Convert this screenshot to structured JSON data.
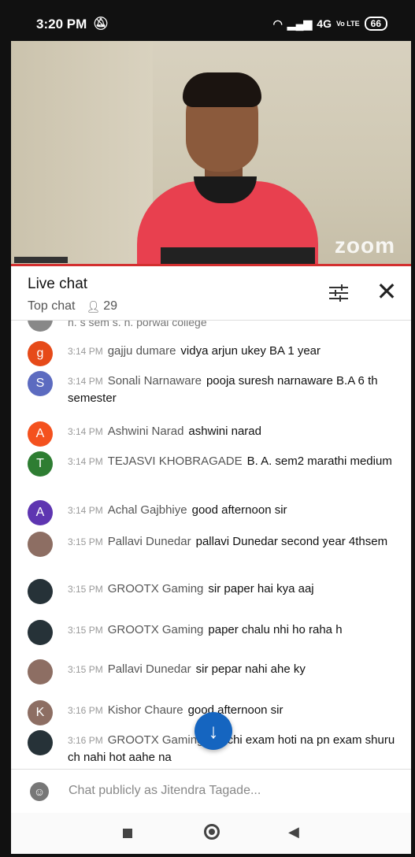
{
  "status_bar": {
    "time": "3:20 PM",
    "network": "4G",
    "volte": "Vo LTE",
    "battery": "66"
  },
  "video": {
    "watermark": "zoom"
  },
  "chat_header": {
    "title": "Live chat",
    "mode": "Top chat",
    "viewers": "29"
  },
  "partial_message": "h. s sem s. n. porwal college",
  "messages": [
    {
      "time": "3:14 PM",
      "author": "gajju dumare",
      "text": "vidya arjun ukey BA 1 year",
      "avatar_letter": "g",
      "avatar_color": "#e64a19"
    },
    {
      "time": "3:14 PM",
      "author": "Sonali Narnaware",
      "text": "pooja suresh narnaware B.A 6 th semester",
      "avatar_letter": "S",
      "avatar_color": "#5c6bc0"
    },
    {
      "time": "3:14 PM",
      "author": "Ashwini Narad",
      "text": "ashwini narad",
      "avatar_letter": "A",
      "avatar_color": "#f4511e"
    },
    {
      "time": "3:14 PM",
      "author": "TEJASVI KHOBRAGADE",
      "text": "B. A. sem2 marathi medium",
      "avatar_letter": "T",
      "avatar_color": "#2e7d32"
    },
    {
      "time": "3:14 PM",
      "author": "Achal Gajbhiye",
      "text": "good afternoon sir",
      "avatar_letter": "A",
      "avatar_color": "#5e35b1"
    },
    {
      "time": "3:15 PM",
      "author": "Pallavi Dunedar",
      "text": "pallavi Dunedar second year 4thsem",
      "avatar_letter": "",
      "avatar_color": "#8d6e63"
    },
    {
      "time": "3:15 PM",
      "author": "GROOTX Gaming",
      "text": "sir paper hai kya aaj",
      "avatar_letter": "",
      "avatar_color": "#263238"
    },
    {
      "time": "3:15 PM",
      "author": "GROOTX Gaming",
      "text": "paper chalu nhi ho raha h",
      "avatar_letter": "",
      "avatar_color": "#263238"
    },
    {
      "time": "3:15 PM",
      "author": "Pallavi Dunedar",
      "text": "sir pepar nahi ahe ky",
      "avatar_letter": "",
      "avatar_color": "#8d6e63"
    },
    {
      "time": "3:16 PM",
      "author": "Kishor Chaure",
      "text": "good afternoon sir",
      "avatar_letter": "K",
      "avatar_color": "#8d6e63"
    },
    {
      "time": "3:16 PM",
      "author": "GROOTX Gaming",
      "text": "aaj chi exam hoti na pn exam shuru ch nahi hot aahe na",
      "avatar_letter": "",
      "avatar_color": "#263238"
    }
  ],
  "input": {
    "placeholder": "Chat publicly as Jitendra Tagade..."
  }
}
